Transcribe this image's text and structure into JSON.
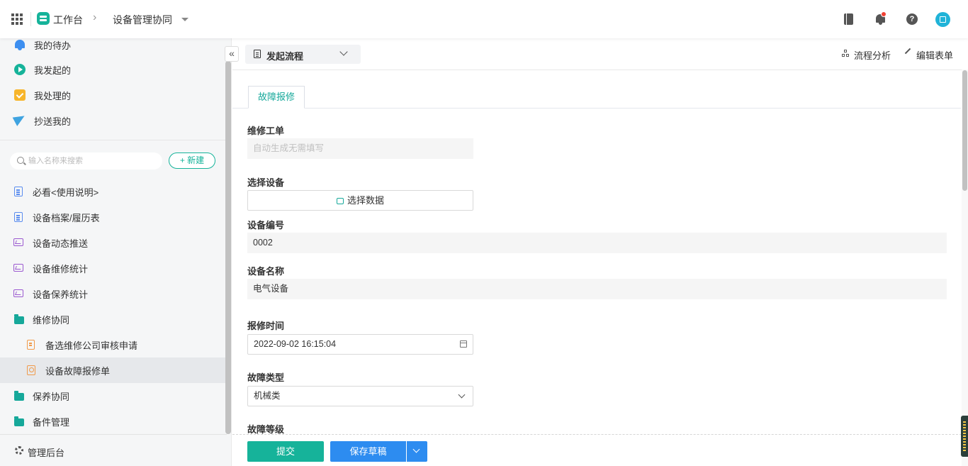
{
  "header": {
    "app_title": "工作台",
    "current": "设备管理协同"
  },
  "sidebar": {
    "quick_items": [
      {
        "label": "我的待办",
        "icon": "bell-icon"
      },
      {
        "label": "我发起的",
        "icon": "play-icon"
      },
      {
        "label": "我处理的",
        "icon": "check-icon"
      },
      {
        "label": "抄送我的",
        "icon": "send-icon"
      }
    ],
    "search_placeholder": "输入名称来搜索",
    "new_label": "+ 新建",
    "tree": [
      {
        "label": "必看<使用说明>",
        "icon": "document-icon"
      },
      {
        "label": "设备档案/履历表",
        "icon": "document-icon"
      },
      {
        "label": "设备动态推送",
        "icon": "chart-icon"
      },
      {
        "label": "设备维修统计",
        "icon": "chart-icon"
      },
      {
        "label": "设备保养统计",
        "icon": "chart-icon"
      },
      {
        "label": "维修协同",
        "icon": "folder-icon"
      },
      {
        "label": "备选维修公司审核申请",
        "icon": "document-icon"
      },
      {
        "label": "设备故障报修单",
        "icon": "form-icon",
        "active": true
      },
      {
        "label": "保养协同",
        "icon": "folder-icon"
      },
      {
        "label": "备件管理",
        "icon": "folder-icon"
      }
    ],
    "footer_label": "管理后台"
  },
  "toolbar": {
    "flow_label": "发起流程",
    "analysis_label": "流程分析",
    "edit_label": "编辑表单"
  },
  "form": {
    "tab_label": "故障报修",
    "work_order": {
      "label": "维修工单",
      "placeholder": "自动生成无需填写"
    },
    "select_device": {
      "label": "选择设备",
      "button": "选择数据"
    },
    "device_no": {
      "label": "设备编号",
      "value": "0002"
    },
    "device_name": {
      "label": "设备名称",
      "value": "电气设备"
    },
    "report_time": {
      "label": "报修时间",
      "value": "2022-09-02 16:15:04"
    },
    "fault_type": {
      "label": "故障类型",
      "value": "机械类"
    },
    "fault_level": {
      "label": "故障等级"
    }
  },
  "actions": {
    "submit": "提交",
    "save_draft": "保存草稿"
  },
  "colors": {
    "primary_green": "#16b39a",
    "primary_blue": "#2d8cf0"
  }
}
